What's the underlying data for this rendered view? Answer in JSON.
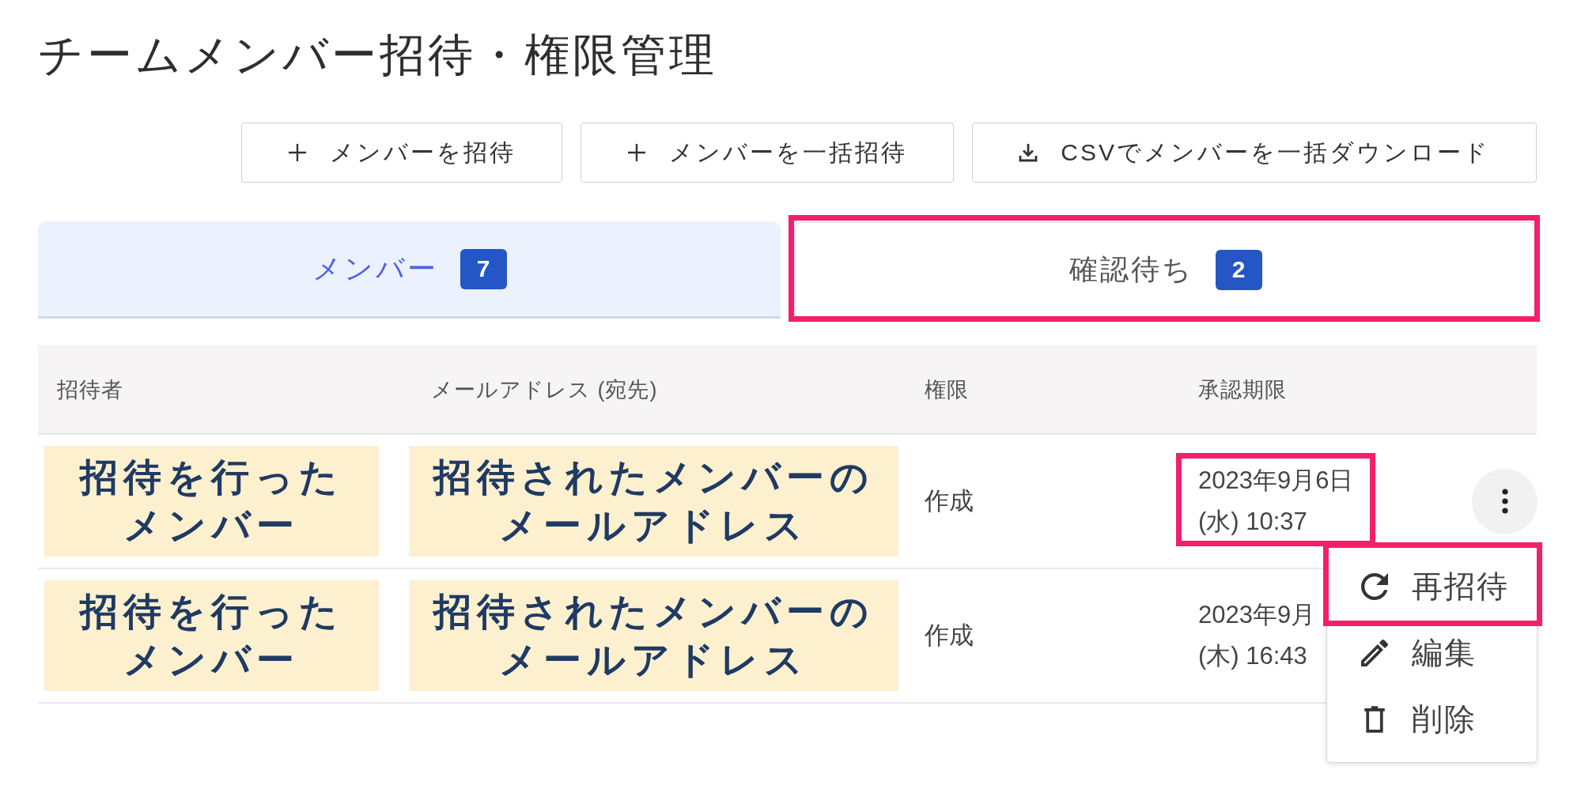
{
  "page": {
    "title": "チームメンバー招待・権限管理"
  },
  "toolbar": {
    "buttons": [
      {
        "kind": "add",
        "label": "メンバーを招待"
      },
      {
        "kind": "add",
        "label": "メンバーを一括招待"
      },
      {
        "kind": "download",
        "label": "CSVでメンバーを一括ダウンロード"
      }
    ]
  },
  "tabs": [
    {
      "label": "メンバー",
      "count": "7",
      "selected": false,
      "highlighted": false
    },
    {
      "label": "確認待ち",
      "count": "2",
      "selected": true,
      "highlighted": true
    }
  ],
  "table": {
    "columns": [
      "招待者",
      "メールアドレス (宛先)",
      "権限",
      "承認期限"
    ],
    "rows": [
      {
        "inviter": [
          "招待を行った",
          "メンバー"
        ],
        "email": [
          "招待されたメンバーの",
          "メールアドレス"
        ],
        "role": "作成",
        "deadline": [
          "2023年9月6日",
          "(水) 10:37"
        ],
        "deadline_highlighted": true,
        "menu_button": true,
        "menu_open": true
      },
      {
        "inviter": [
          "招待を行った",
          "メンバー"
        ],
        "email": [
          "招待されたメンバーの",
          "メールアドレス"
        ],
        "role": "作成",
        "deadline": [
          "2023年9月",
          "(木) 16:43"
        ],
        "deadline_highlighted": false
      }
    ]
  },
  "row_menu": {
    "items": [
      {
        "kind": "reinvite",
        "label": "再招待",
        "highlighted": true
      },
      {
        "kind": "edit",
        "label": "編集",
        "highlighted": false
      },
      {
        "kind": "delete",
        "label": "削除",
        "highlighted": false
      }
    ]
  }
}
